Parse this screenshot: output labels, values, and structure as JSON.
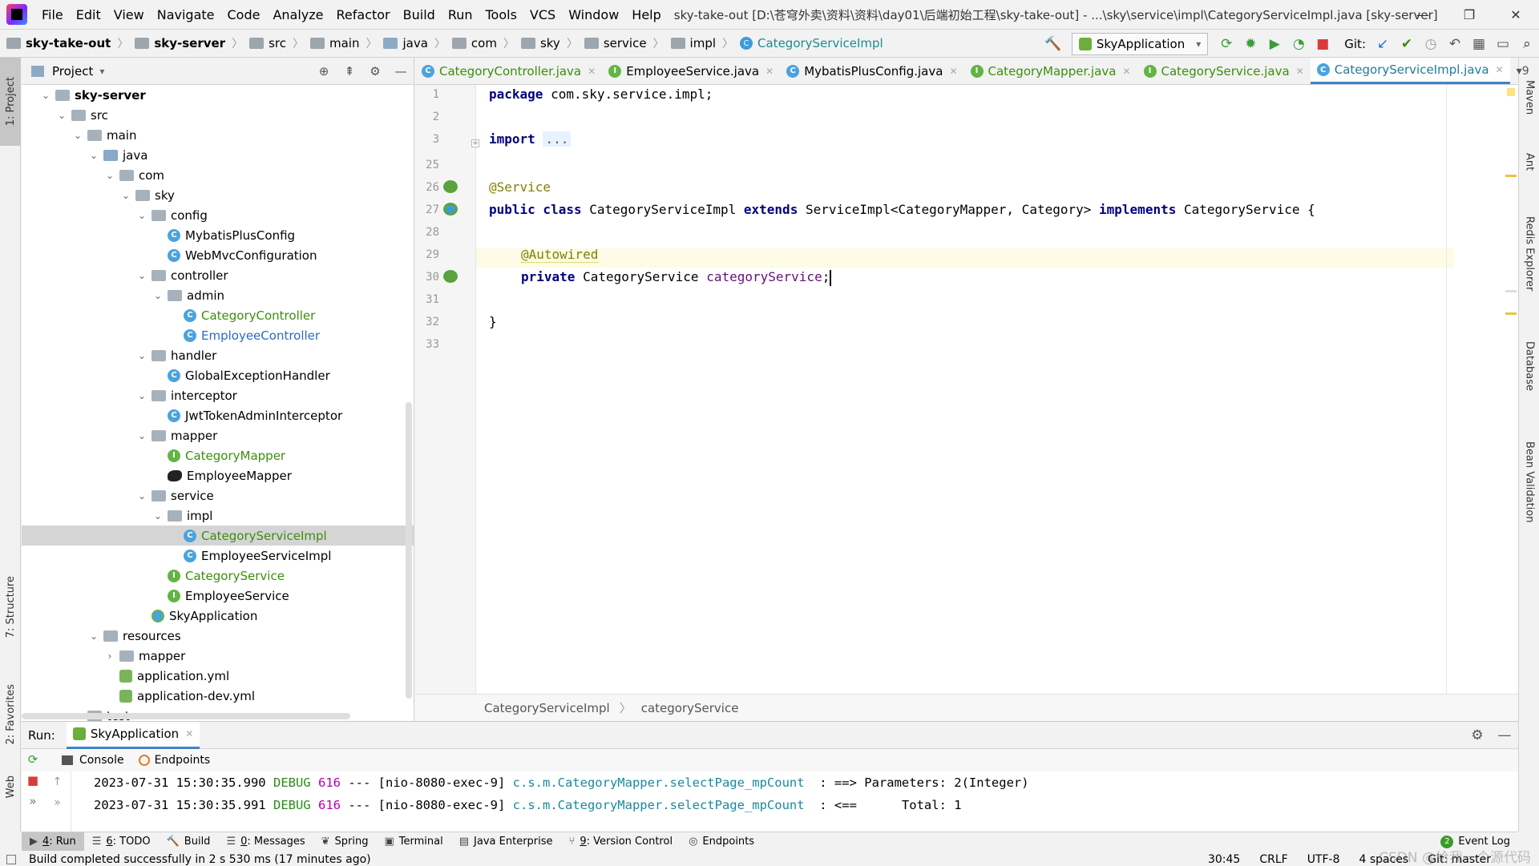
{
  "menubar": {
    "items": [
      "File",
      "Edit",
      "View",
      "Navigate",
      "Code",
      "Analyze",
      "Refactor",
      "Build",
      "Run",
      "Tools",
      "VCS",
      "Window",
      "Help"
    ],
    "title": "sky-take-out [D:\\苍穹外卖\\资料\\资料\\day01\\后端初始工程\\sky-take-out] - ...\\sky\\service\\impl\\CategoryServiceImpl.java [sky-server]",
    "minimize": "—",
    "restore": "❐",
    "close": "✕"
  },
  "navbar": {
    "crumbs": [
      "sky-take-out",
      "sky-server",
      "src",
      "main",
      "java",
      "com",
      "sky",
      "service",
      "impl",
      "CategoryServiceImpl"
    ],
    "run_config": "SkyApplication",
    "git_label": "Git:"
  },
  "left_stripe": {
    "project": "1: Project",
    "structure": "7: Structure",
    "favorites": "2: Favorites",
    "web": "Web"
  },
  "right_stripe": {
    "maven": "Maven",
    "ant": "Ant",
    "redis": "Redis Explorer",
    "database": "Database",
    "bean": "Bean Validation"
  },
  "project": {
    "header": "Project",
    "tree": [
      {
        "label": "sky-server",
        "depth": 1,
        "type": "module",
        "expanded": true,
        "bold": true
      },
      {
        "label": "src",
        "depth": 2,
        "type": "folder",
        "expanded": true
      },
      {
        "label": "main",
        "depth": 3,
        "type": "folder",
        "expanded": true
      },
      {
        "label": "java",
        "depth": 4,
        "type": "src",
        "expanded": true
      },
      {
        "label": "com",
        "depth": 5,
        "type": "folder",
        "expanded": true
      },
      {
        "label": "sky",
        "depth": 6,
        "type": "folder",
        "expanded": true
      },
      {
        "label": "config",
        "depth": 7,
        "type": "folder",
        "expanded": true
      },
      {
        "label": "MybatisPlusConfig",
        "depth": 8,
        "type": "class"
      },
      {
        "label": "WebMvcConfiguration",
        "depth": 8,
        "type": "class"
      },
      {
        "label": "controller",
        "depth": 7,
        "type": "folder",
        "expanded": true
      },
      {
        "label": "admin",
        "depth": 8,
        "type": "folder",
        "expanded": true
      },
      {
        "label": "CategoryController",
        "depth": 9,
        "type": "class",
        "color": "green"
      },
      {
        "label": "EmployeeController",
        "depth": 9,
        "type": "class",
        "color": "blue"
      },
      {
        "label": "handler",
        "depth": 7,
        "type": "folder",
        "expanded": true
      },
      {
        "label": "GlobalExceptionHandler",
        "depth": 8,
        "type": "class"
      },
      {
        "label": "interceptor",
        "depth": 7,
        "type": "folder",
        "expanded": true
      },
      {
        "label": "JwtTokenAdminInterceptor",
        "depth": 8,
        "type": "class"
      },
      {
        "label": "mapper",
        "depth": 7,
        "type": "folder",
        "expanded": true
      },
      {
        "label": "CategoryMapper",
        "depth": 8,
        "type": "interface",
        "color": "green"
      },
      {
        "label": "EmployeeMapper",
        "depth": 8,
        "type": "bird"
      },
      {
        "label": "service",
        "depth": 7,
        "type": "folder",
        "expanded": true
      },
      {
        "label": "impl",
        "depth": 8,
        "type": "folder",
        "expanded": true
      },
      {
        "label": "CategoryServiceImpl",
        "depth": 9,
        "type": "class",
        "color": "green",
        "selected": true
      },
      {
        "label": "EmployeeServiceImpl",
        "depth": 9,
        "type": "class"
      },
      {
        "label": "CategoryService",
        "depth": 8,
        "type": "interface",
        "color": "green"
      },
      {
        "label": "EmployeeService",
        "depth": 8,
        "type": "interface"
      },
      {
        "label": "SkyApplication",
        "depth": 7,
        "type": "app"
      },
      {
        "label": "resources",
        "depth": 4,
        "type": "res",
        "expanded": true
      },
      {
        "label": "mapper",
        "depth": 5,
        "type": "folder",
        "expanded": false
      },
      {
        "label": "application.yml",
        "depth": 5,
        "type": "yml"
      },
      {
        "label": "application-dev.yml",
        "depth": 5,
        "type": "yml"
      },
      {
        "label": "test",
        "depth": 3,
        "type": "folder",
        "expanded": false
      }
    ]
  },
  "editor": {
    "tabs": [
      {
        "label": "CategoryController.java",
        "icon": "C",
        "color": "green"
      },
      {
        "label": "EmployeeService.java",
        "icon": "I",
        "color": "none"
      },
      {
        "label": "MybatisPlusConfig.java",
        "icon": "C",
        "color": "none"
      },
      {
        "label": "CategoryMapper.java",
        "icon": "I",
        "color": "green"
      },
      {
        "label": "CategoryService.java",
        "icon": "I",
        "color": "green"
      },
      {
        "label": "CategoryServiceImpl.java",
        "icon": "C",
        "color": "teal",
        "active": true
      }
    ],
    "tabs_more": "▾9",
    "lines": [
      "1",
      "2",
      "3",
      "25",
      "26",
      "27",
      "28",
      "29",
      "30",
      "31",
      "32",
      "33"
    ],
    "code": {
      "l1_kw": "package",
      "l1_rest": " com.sky.service.impl;",
      "l3_kw": "import",
      "l3_fold": "...",
      "l26_ann": "@Service",
      "l27_kw1": "public class",
      "l27_a": " CategoryServiceImpl ",
      "l27_kw2": "extends",
      "l27_b": " ServiceImpl<CategoryMapper, Category> ",
      "l27_kw3": "implements",
      "l27_c": " CategoryService {",
      "l29_ann": "@Autowired",
      "l30_kw": "private",
      "l30_type": " CategoryService ",
      "l30_field": "categoryService",
      "l30_end": ";",
      "l32": "}"
    },
    "breadcrumb": [
      "CategoryServiceImpl",
      "categoryService"
    ]
  },
  "run": {
    "label": "Run:",
    "tab": "SkyApplication",
    "subtabs": [
      "Console",
      "Endpoints"
    ],
    "logs": [
      {
        "time": "2023-07-31 15:30:35.990",
        "level": "DEBUG",
        "pid": "616",
        "sep": " --- ",
        "thread": "[nio-8080-exec-9]",
        "logger": "c.s.m.CategoryMapper.selectPage_mpCount",
        "msg": "  : ==> Parameters: 2(Integer)"
      },
      {
        "time": "2023-07-31 15:30:35.991",
        "level": "DEBUG",
        "pid": "616",
        "sep": " --- ",
        "thread": "[nio-8080-exec-9]",
        "logger": "c.s.m.CategoryMapper.selectPage_mpCount",
        "msg": "  : <==      Total: 1"
      }
    ]
  },
  "bottom_tools": [
    {
      "num": "4",
      "label": ": Run",
      "active": true,
      "icon": "▶"
    },
    {
      "num": "6",
      "label": ": TODO",
      "icon": "☰"
    },
    {
      "num": "",
      "label": "Build",
      "icon": "🔨"
    },
    {
      "num": "0",
      "label": ": Messages",
      "icon": "☰"
    },
    {
      "num": "",
      "label": "Spring",
      "icon": "❦"
    },
    {
      "num": "",
      "label": "Terminal",
      "icon": "▣"
    },
    {
      "num": "",
      "label": "Java Enterprise",
      "icon": "▤"
    },
    {
      "num": "9",
      "label": ": Version Control",
      "icon": "⑂"
    },
    {
      "num": "",
      "label": "Endpoints",
      "icon": "◎"
    }
  ],
  "event_log": {
    "count": "2",
    "label": "Event Log"
  },
  "status": {
    "message": "Build completed successfully in 2 s 530 ms (17 minutes ago)",
    "position": "30:45",
    "line_sep": "CRLF",
    "encoding": "UTF-8",
    "indent": "4 spaces",
    "git": "Git: master",
    "watermark": "CSDN @给我一个源代码"
  },
  "colors": {
    "accent": "#4083c9",
    "keyword": "#000080",
    "annotation": "#808000",
    "field": "#660e7a",
    "debug": "#2b8a1c"
  }
}
